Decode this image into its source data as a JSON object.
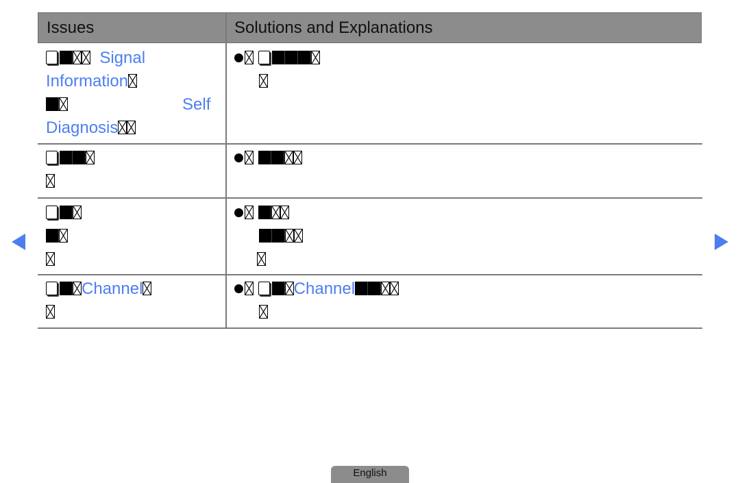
{
  "table": {
    "headers": {
      "issues": "Issues",
      "solutions": "Solutions and Explanations"
    },
    "rows": [
      {
        "issue": {
          "line1_term": "Signal",
          "line2_term": "Information",
          "line3_term": "Self",
          "line4_term": "Diagnosis"
        },
        "solution": {
          "bullet": "●"
        }
      },
      {
        "issue": {},
        "solution": {
          "bullet": "●"
        }
      },
      {
        "issue": {},
        "solution": {
          "bullet": "●"
        }
      },
      {
        "issue": {
          "line1_term": "Channel"
        },
        "solution": {
          "bullet": "●",
          "line1_term": "Channel"
        }
      }
    ]
  },
  "navigation": {
    "prev_icon": "arrow-left-icon",
    "next_icon": "arrow-right-icon"
  },
  "footer": {
    "language_tab": "English"
  },
  "colors": {
    "header_bg": "#8c8c8c",
    "link_blue": "#4d7ef0",
    "grid_line": "#7a7a7a"
  }
}
